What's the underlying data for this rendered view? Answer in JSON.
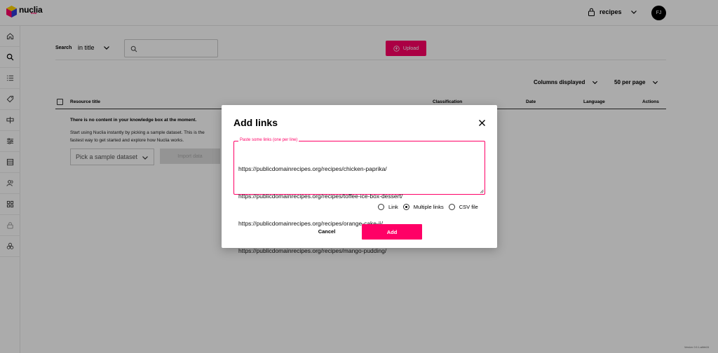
{
  "app": {
    "logo_text": "nuclia",
    "logo_sub": "beta",
    "kb_name": "recipes",
    "avatar_initials": "FJ",
    "version": "Version: 0.9.1-a4feb24",
    "accent": "#ff0066"
  },
  "sidebar": {
    "items": [
      "home-icon",
      "search-icon",
      "list-icon",
      "tag-icon",
      "widget-icon",
      "sliders-icon",
      "database-icon",
      "users-icon",
      "grid-icon",
      "lock-icon",
      "cubes-icon"
    ]
  },
  "search": {
    "label": "Search",
    "scope": "in title",
    "placeholder": ""
  },
  "upload_label": "Upload",
  "table": {
    "columns_displayed": "Columns displayed",
    "per_page": "50 per page",
    "headers": [
      "Resource title",
      "Classification",
      "Date",
      "Language",
      "Actions"
    ]
  },
  "empty": {
    "title": "There is no content in your knowledge box at the moment.",
    "description": "Start using Nuclia instantly by picking a sample dataset. This is the fastest way to get started and explore how Nuclia works.",
    "sample_placeholder": "Pick a sample dataset",
    "import_label": "Import data"
  },
  "modal": {
    "title": "Add links",
    "field_label": "Paste some links (one per line)",
    "links": [
      "https://publicdomainrecipes.org/recipes/chicken-paprika/",
      "https://publicdomainrecipes.org/recipes/toffee-ice-box-dessert/",
      "https://publicdomainrecipes.org/recipes/orange-cake-ii/",
      "https://publicdomainrecipes.org/recipes/mango-pudding/"
    ],
    "options": [
      {
        "label": "Link",
        "selected": false
      },
      {
        "label": "Multiple links",
        "selected": true
      },
      {
        "label": "CSV file",
        "selected": false
      }
    ],
    "cancel_label": "Cancel",
    "add_label": "Add"
  }
}
